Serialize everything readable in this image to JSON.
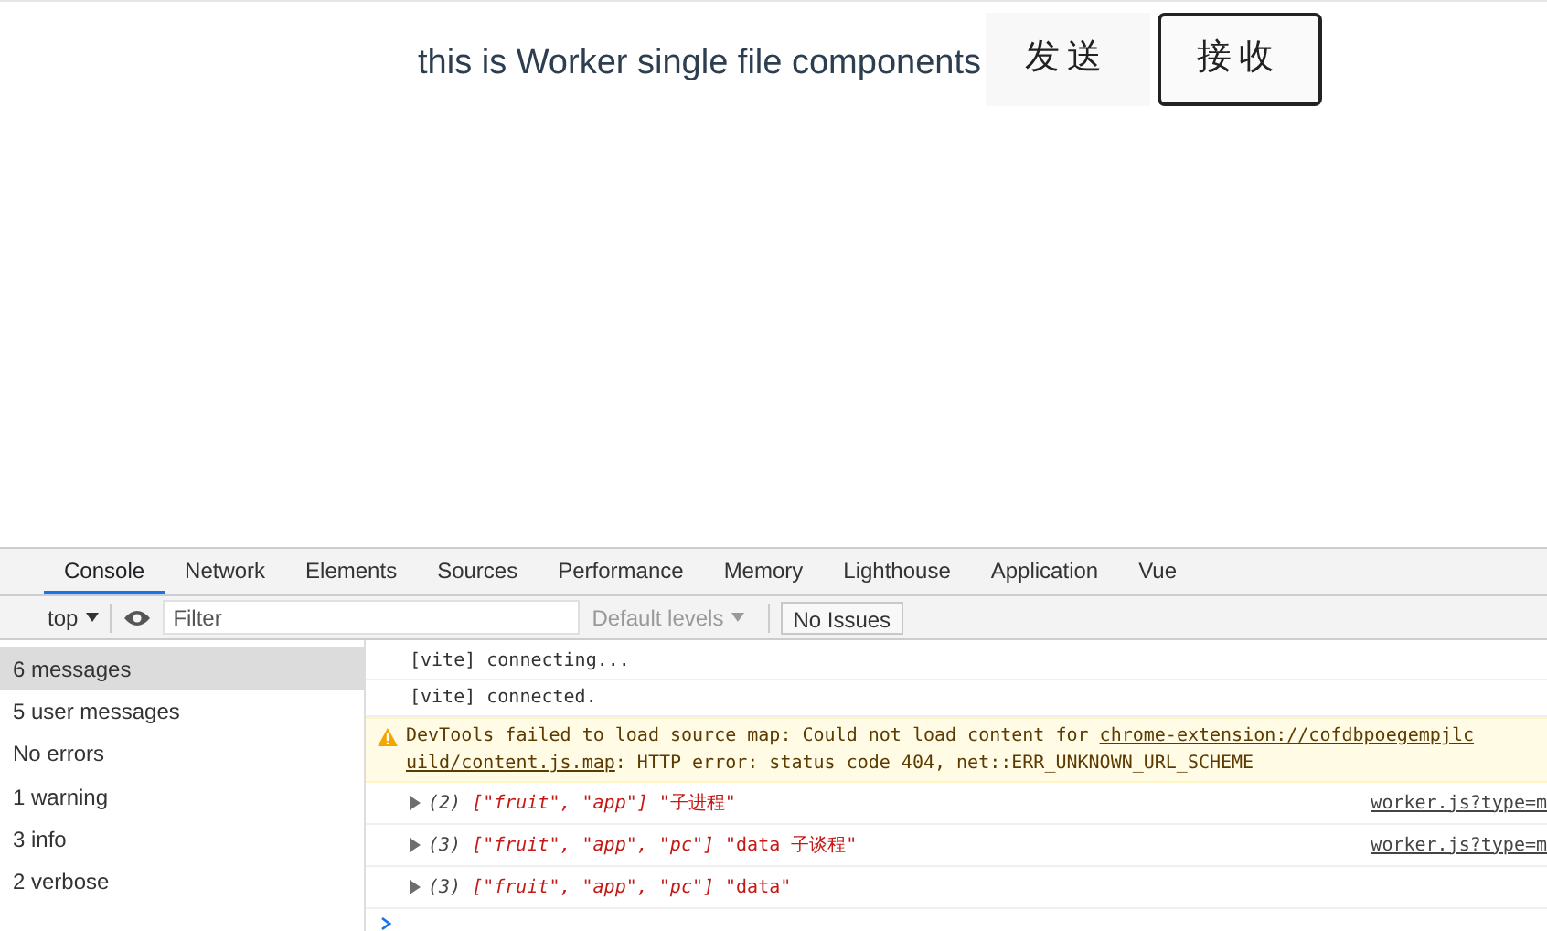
{
  "page": {
    "heading": "this is Worker single file components",
    "buttons": [
      {
        "label": "发送",
        "kind": "flat"
      },
      {
        "label": "接收",
        "kind": "outlined"
      }
    ]
  },
  "devtools": {
    "tabs": [
      {
        "label": "Console",
        "selected": true
      },
      {
        "label": "Network",
        "selected": false
      },
      {
        "label": "Elements",
        "selected": false
      },
      {
        "label": "Sources",
        "selected": false
      },
      {
        "label": "Performance",
        "selected": false
      },
      {
        "label": "Memory",
        "selected": false
      },
      {
        "label": "Lighthouse",
        "selected": false
      },
      {
        "label": "Application",
        "selected": false
      },
      {
        "label": "Vue",
        "selected": false
      }
    ],
    "toolbar": {
      "context": "top",
      "filter_placeholder": "Filter",
      "levels": "Default levels",
      "issues": "No Issues"
    },
    "sidebar": [
      {
        "label": "6 messages",
        "selected": true
      },
      {
        "label": "5 user messages",
        "selected": false
      },
      {
        "label": "No errors",
        "selected": false
      },
      {
        "label": "1 warning",
        "selected": false
      },
      {
        "label": "3 info",
        "selected": false
      },
      {
        "label": "2 verbose",
        "selected": false
      }
    ],
    "messages": [
      {
        "kind": "log",
        "text": "[vite] connecting..."
      },
      {
        "kind": "log",
        "text": "[vite] connected."
      },
      {
        "kind": "warning",
        "text": "DevTools failed to load source map: Could not load content for ",
        "link": "chrome-extension://cofdbpoegempjlc",
        "link2": "uild/content.js.map",
        "rest": ": HTTP error: status code 404, net::ERR_UNKNOWN_URL_SCHEME"
      },
      {
        "kind": "object",
        "count": "(2)",
        "array": "[\"fruit\", \"app\"]",
        "value": "\"子进程\"",
        "source": "worker.js?type=m"
      },
      {
        "kind": "object",
        "count": "(3)",
        "array": "[\"fruit\", \"app\", \"pc\"]",
        "value": "\"data 子谈程\"",
        "source": "worker.js?type=m"
      },
      {
        "kind": "object",
        "count": "(3)",
        "array": "[\"fruit\", \"app\", \"pc\"]",
        "value": "\"data\""
      }
    ]
  }
}
